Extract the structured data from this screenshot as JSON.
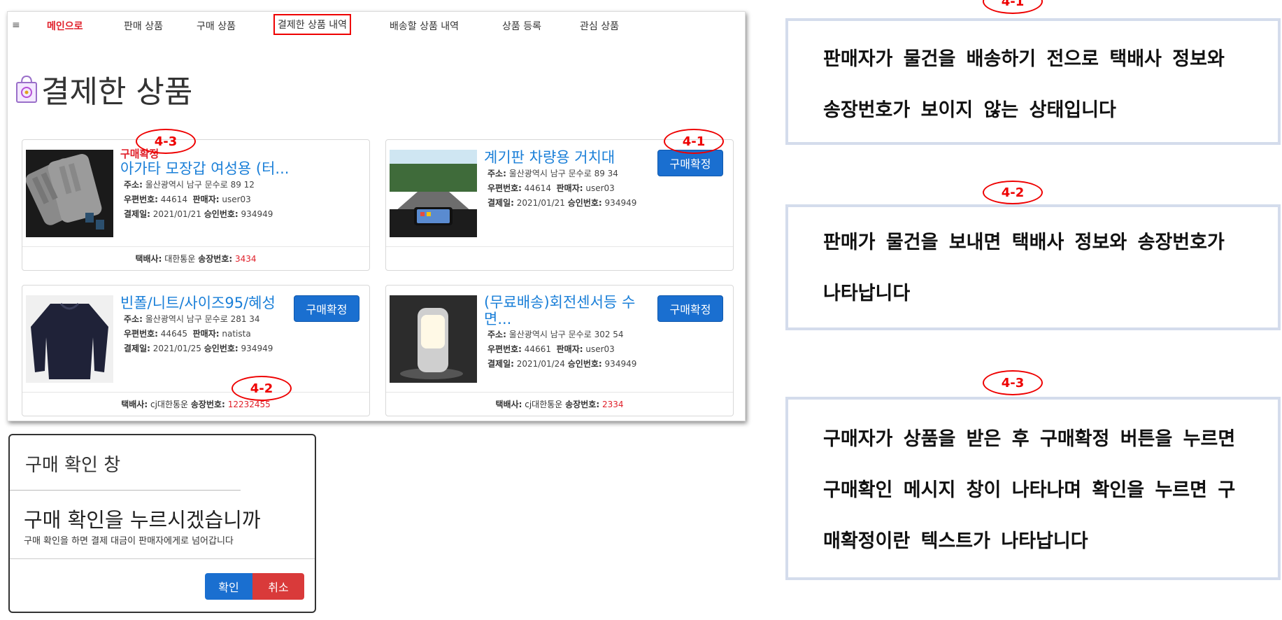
{
  "nav": {
    "menu_icon": "≡",
    "items": [
      "메인으로",
      "판매 상품",
      "구매 상품",
      "결제한 상품 내역",
      "배송할 상품 내역",
      "상품 등록",
      "관심 상품"
    ]
  },
  "page_title": "결제한 상품",
  "labels": {
    "address": "주소:",
    "zip": "우편번호:",
    "seller": "판매자:",
    "paydate": "결제일:",
    "approval": "승인번호:",
    "courier": "택배사:",
    "invoice": "송장번호:",
    "confirm_button": "구매확정"
  },
  "cards": [
    {
      "status": "구매확정",
      "title": "아가타 모장갑 여성용 (터...",
      "address": "울산광역시 남구 문수로 89 12",
      "zip": "44614",
      "seller": "user03",
      "paydate": "2021/01/21",
      "approval": "934949",
      "courier": "대한통운",
      "invoice": "3434",
      "annotation": "4-3"
    },
    {
      "title": "계기판 차량용 거치대",
      "address": "울산광역시 남구 문수로 89 34",
      "zip": "44614",
      "seller": "user03",
      "paydate": "2021/01/21",
      "approval": "934949",
      "annotation": "4-1"
    },
    {
      "title": "빈폴/니트/사이즈95/혜성",
      "address": "울산광역시 남구 문수로 281 34",
      "zip": "44645",
      "seller": "natista",
      "paydate": "2021/01/25",
      "approval": "934949",
      "courier": "cj대한통운",
      "invoice": "12232455",
      "annotation": "4-2"
    },
    {
      "title": "(무료배송)회전센서등 수면...",
      "address": "울산광역시 남구 문수로 302 54",
      "zip": "44661",
      "seller": "user03",
      "paydate": "2021/01/24",
      "approval": "934949",
      "courier": "cj대한통운",
      "invoice": "2334"
    }
  ],
  "modal": {
    "title": "구매 확인 창",
    "heading": "구매 확인을 누르시겠습니까",
    "description": "구매 확인을 하면 결제 대금이 판매자에게로 넘어갑니다",
    "ok": "확인",
    "cancel": "취소"
  },
  "notes": [
    {
      "tag": "4-1",
      "line1": "판매자가 물건을 배송하기 전으로 택배사 정보와",
      "line2": "송장번호가 보이지 않는 상태입니다"
    },
    {
      "tag": "4-2",
      "line1": "판매가 물건을 보내면 택배사 정보와 송장번호가",
      "line2": "나타납니다"
    },
    {
      "tag": "4-3",
      "line1": "구매자가 상품을 받은 후 구매확정 버튼을 누르면",
      "line2": "구매확인 메시지 창이 나타나며 확인을 누르면 구",
      "line3": "매확정이란 텍스트가 나타납니다"
    }
  ],
  "colors": {
    "accent_blue": "#1a6fd0",
    "link_blue": "#1a7fd8",
    "alert_red": "#e0202a",
    "note_border": "#d4dcec"
  }
}
